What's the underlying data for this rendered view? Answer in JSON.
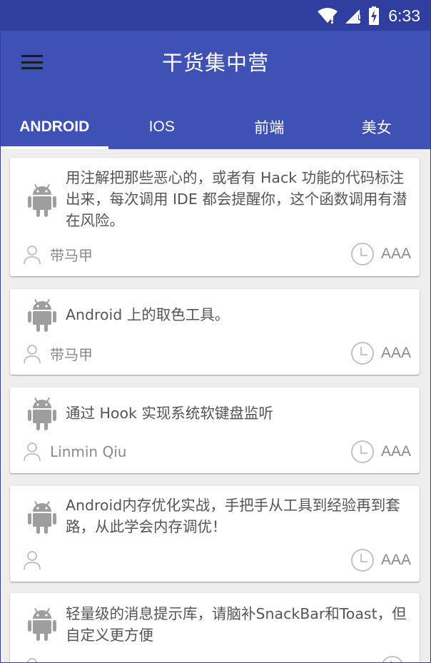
{
  "status_bar": {
    "time": "6:33",
    "wifi_icon": "wifi-icon",
    "signal_icon": "cell-signal-icon",
    "battery_icon": "battery-charging-icon"
  },
  "app_bar": {
    "title": "干货集中营",
    "menu_icon": "hamburger-menu-icon",
    "background": "#3f51b5",
    "status_background": "#303f9f"
  },
  "tabs": [
    {
      "label": "ANDROID",
      "selected": true
    },
    {
      "label": "IOS",
      "selected": false
    },
    {
      "label": "前端",
      "selected": false
    },
    {
      "label": "美女",
      "selected": false
    }
  ],
  "items": [
    {
      "desc": "用注解把那些恶心的，或者有 Hack 功能的代码标注出来，每次调用 IDE 都会提醒你，这个函数调用有潜在风险。",
      "author": "带马甲",
      "time": "AAA"
    },
    {
      "desc": "Android 上的取色工具。",
      "author": "带马甲",
      "time": "AAA"
    },
    {
      "desc": "通过 Hook 实现系统软键盘监听",
      "author": "Linmin Qiu",
      "time": "AAA"
    },
    {
      "desc": "Android内存优化实战，手把手从工具到经验再到套路，从此学会内存调优！",
      "author": "",
      "time": "AAA"
    },
    {
      "desc": "轻量级的消息提示库，请脑补SnackBar和Toast，但自定义更方便",
      "author": "",
      "time": ""
    }
  ]
}
